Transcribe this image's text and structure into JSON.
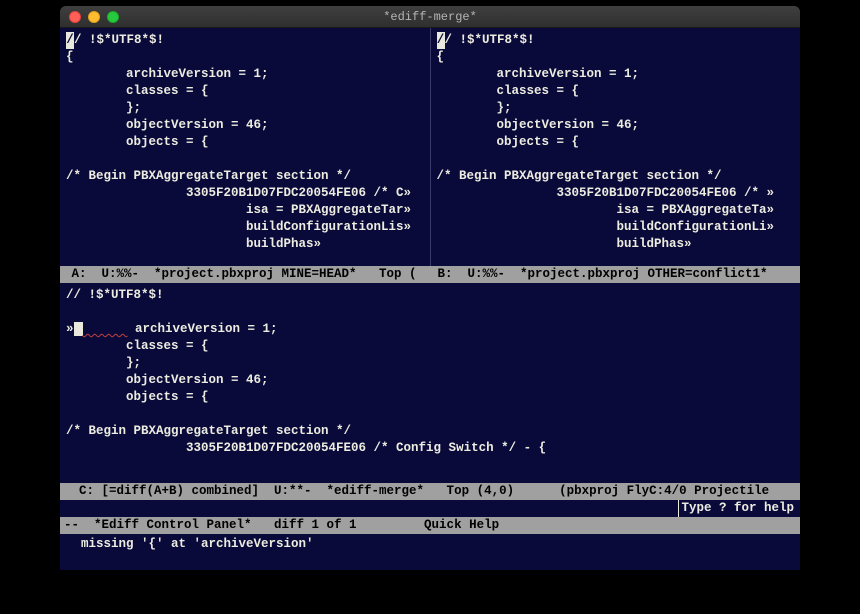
{
  "titlebar": {
    "title": "*ediff-merge*"
  },
  "paneA": {
    "lines": [
      "// !$*UTF8*$!",
      "{",
      "        archiveVersion = 1;",
      "        classes = {",
      "        };",
      "        objectVersion = 46;",
      "        objects = {",
      "",
      "/* Begin PBXAggregateTarget section */",
      "                3305F20B1D07FDC20054FE06 /* C»",
      "                        isa = PBXAggregateTar»",
      "                        buildConfigurationLis»",
      "                        buildPhas»"
    ],
    "modeline": " A:  U:%%-  *project.pbxproj MINE=HEAD*   Top ("
  },
  "paneB": {
    "lines": [
      "// !$*UTF8*$!",
      "{",
      "        archiveVersion = 1;",
      "        classes = {",
      "        };",
      "        objectVersion = 46;",
      "        objects = {",
      "",
      "/* Begin PBXAggregateTarget section */",
      "                3305F20B1D07FDC20054FE06 /* »",
      "                        isa = PBXAggregateTa»",
      "                        buildConfigurationLi»",
      "                        buildPhas»"
    ],
    "modeline": " B:  U:%%-  *project.pbxproj OTHER=conflict1*"
  },
  "paneC": {
    "line1": "// !$*UTF8*$!",
    "diff_marker": "»",
    "line_av": "       archiveVersion = 1;",
    "lines_rest": [
      "        classes = {",
      "        };",
      "        objectVersion = 46;",
      "        objects = {",
      "",
      "/* Begin PBXAggregateTarget section */",
      "                3305F20B1D07FDC20054FE06 /* Config Switch */ - {"
    ],
    "modeline": "  C: [=diff(A+B) combined]  U:**-  *ediff-merge*   Top (4,0)      (pbxproj FlyC:4/0 Projectile"
  },
  "hint": "Type ? for help",
  "control": "--  *Ediff Control Panel*   diff 1 of 1         Quick Help",
  "minibuffer": "  missing '{' at 'archiveVersion'"
}
